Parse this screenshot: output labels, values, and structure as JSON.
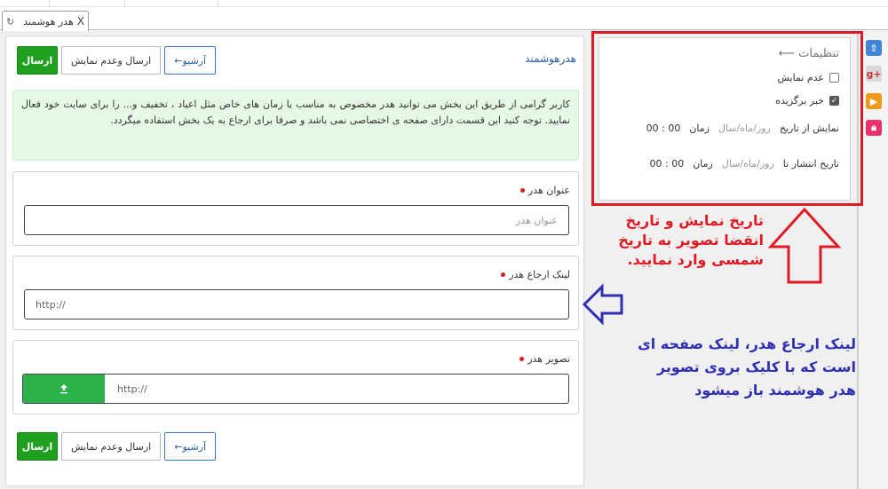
{
  "tab": {
    "label": "هدر هوشمند",
    "close": "X"
  },
  "form": {
    "title": "هدرهوشمند",
    "buttons": {
      "submit": "ارسال",
      "submit_hide": "ارسال وعدم نمایش",
      "archive": "آرشیو←"
    },
    "info": "کاربر گرامی از طریق این بخش می توانید هدر مخصوص به مناسب یا زمان های خاص مثل اعیاد ، تخفیف و... را برای سایت خود فعال نمایید. توجه کنید این قسمت دارای صفحه ی اختصاصی نمی باشد و صرفا برای ارجاع به یک بخش استفاده میگردد.",
    "title_field": {
      "label": "عنوان هدر",
      "placeholder": "عنوان هدر"
    },
    "link_field": {
      "label": "لینک ارجاع هدر",
      "value": "http://"
    },
    "image_field": {
      "label": "تصویر هدر",
      "value": "http://"
    }
  },
  "settings": {
    "title": "تنظیمات",
    "hide_label": "عدم نمایش",
    "hide_checked": false,
    "featured_label": "خبر برگزیده",
    "featured_checked": true,
    "show_from": {
      "label": "نمایش از تاریخ",
      "date_placeholder": "روز/ماه/سال",
      "time_label": "زمان",
      "time": "00 : 00"
    },
    "publish_until": {
      "label": "تاریخ انتشار تا",
      "date_placeholder": "روز/ماه/سال",
      "time_label": "زمان",
      "time": "00 : 00"
    }
  },
  "annotations": {
    "red": "تاریخ نمایش و تاریخ انقضا تصویر به تاریخ شمسی وارد نمایید.",
    "blue": "لینک ارجاع هدر، لینک صفحه ای است که با کلیک بروی تصویر هدر هوشمند باز میشود"
  },
  "colors": {
    "accent_green": "#1fa11f",
    "annotation_red": "#e01a25",
    "annotation_blue": "#2f2fb4",
    "title_blue": "#2a5ea7"
  },
  "icons": [
    "refresh-icon",
    "share-icon",
    "google-plus-icon",
    "video-icon",
    "lock-icon",
    "upload-icon",
    "arrow-left-icon",
    "check-icon"
  ]
}
